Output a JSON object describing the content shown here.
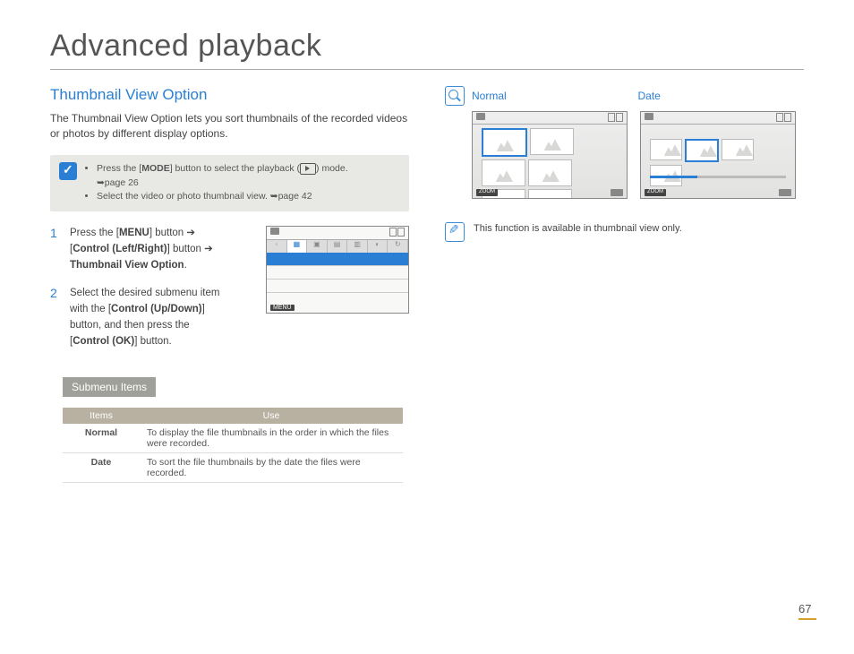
{
  "title": "Advanced playback",
  "section_heading": "Thumbnail View Option",
  "intro": "The Thumbnail View Option lets you sort thumbnails of the recorded videos or photos by different display options.",
  "note_bullets": [
    {
      "pre": "Press the [",
      "bold": "MODE",
      "post": "] button to select the playback (",
      "post2": ") mode.",
      "ref": "➥page 26"
    },
    {
      "text": "Select the video or photo thumbnail view. ➥page 42"
    }
  ],
  "steps": [
    {
      "num": "1",
      "line1_pre": "Press the [",
      "line1_bold": "MENU",
      "line1_post": "] button ➔",
      "line2_pre": "[",
      "line2_bold": "Control (Left/Right)",
      "line2_post": "] button ➔",
      "line3_bold": "Thumbnail View Option",
      "line3_post": "."
    },
    {
      "num": "2",
      "line1": "Select the desired submenu item",
      "line2_pre": "with the [",
      "line2_bold": "Control (Up/Down)",
      "line2_post": "]",
      "line3": "button, and then press the",
      "line4_pre": "[",
      "line4_bold": "Control (OK)",
      "line4_post": "] button."
    }
  ],
  "submenu_heading": "Submenu Items",
  "table": {
    "headers": [
      "Items",
      "Use"
    ],
    "rows": [
      {
        "item": "Normal",
        "use": "To display the file thumbnails in the order in which the files were recorded."
      },
      {
        "item": "Date",
        "use": "To sort the file thumbnails by the date the files were recorded."
      }
    ]
  },
  "right": {
    "label_normal": "Normal",
    "label_date": "Date",
    "zoom_label": "ZOOM",
    "note": "This function is available in thumbnail view only."
  },
  "menu_mock_footer": "MENU",
  "page_number": "67"
}
